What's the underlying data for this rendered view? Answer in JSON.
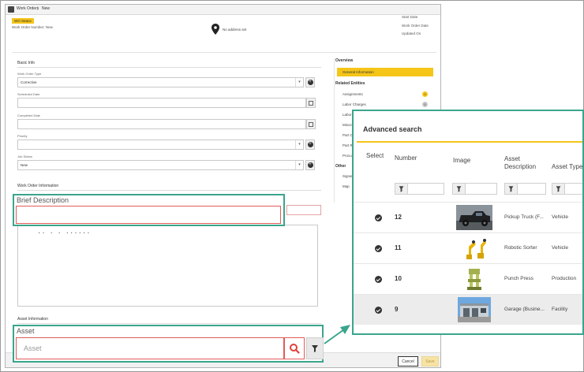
{
  "titlebar": {
    "crumb_root": "Work Orders",
    "crumb_current": "New"
  },
  "header": {
    "status": "WO Status",
    "wo_number": "Work Order Number: New",
    "address": "No address set",
    "dates": [
      "Start Date",
      "Work Order Date",
      "Updated On"
    ]
  },
  "basic_info": {
    "heading": "Basic Info",
    "work_order_type_label": "Work Order Type",
    "work_order_type_value": "Corrective",
    "scheduled_date_label": "Scheduled Date",
    "completed_date_label": "Completed Date",
    "priority_label": "Priority",
    "job_status_label": "Job Status",
    "job_status_value": "New"
  },
  "wo_information": {
    "heading": "Work Order Information",
    "textarea_ghost": "·· · · ······"
  },
  "asset_information": {
    "heading": "Asset Information"
  },
  "nav": {
    "overview": "Overview",
    "active": "General Information",
    "related": "Related Entities",
    "items": [
      "Assignments",
      "Labor Charges",
      "Labor",
      "Misce",
      "Part C",
      "Part R",
      "Procur"
    ],
    "counts": [
      "0",
      "0",
      "0"
    ],
    "other": "Other",
    "other_items": [
      "Signatu",
      "Map"
    ]
  },
  "footer": {
    "cancel": "Cancel",
    "save": "Save"
  },
  "callouts": {
    "brief_description_title": "Brief Description",
    "asset_title": "Asset",
    "asset_placeholder": "Asset"
  },
  "advanced_search": {
    "title": "Advanced search",
    "columns": [
      "Select",
      "Number",
      "Image",
      "Asset Description",
      "Asset Type"
    ],
    "rows": [
      {
        "number": "12",
        "description": "Pickup Truck (F...",
        "type": "Vehicle",
        "image": "pickup-truck"
      },
      {
        "number": "11",
        "description": "Robotic Sorter",
        "type": "Vehicle",
        "image": "robotic-arm"
      },
      {
        "number": "10",
        "description": "Punch Press",
        "type": "Production",
        "image": "punch-press"
      },
      {
        "number": "9",
        "description": "Garage (Busine...",
        "type": "Facility",
        "image": "garage-building"
      }
    ]
  },
  "colors": {
    "accent": "#f5c518",
    "callout": "#3aa58c",
    "error": "#e05a5a"
  }
}
